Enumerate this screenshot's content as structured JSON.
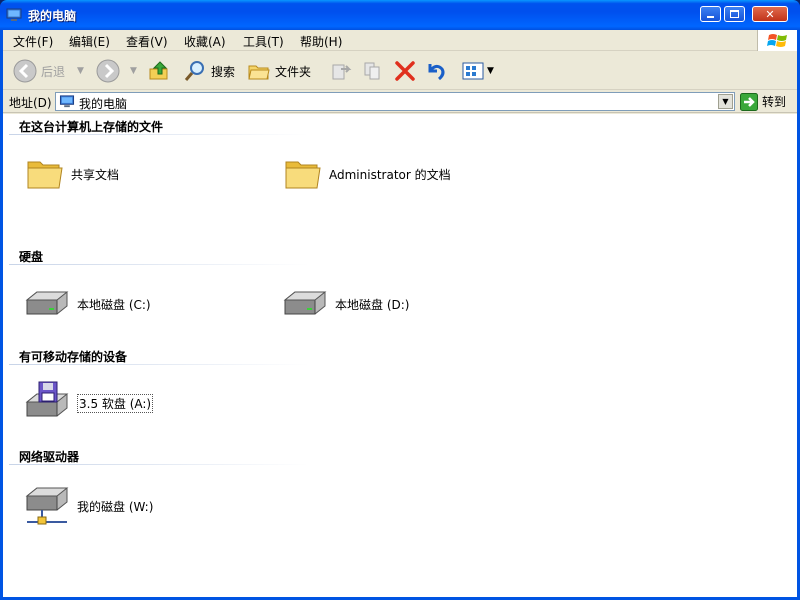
{
  "window": {
    "title": "我的电脑"
  },
  "menu": [
    "文件(F)",
    "编辑(E)",
    "查看(V)",
    "收藏(A)",
    "工具(T)",
    "帮助(H)"
  ],
  "toolbar": {
    "back": "后退",
    "search": "搜索",
    "folders": "文件夹"
  },
  "address": {
    "label": "地址(D)",
    "value": "我的电脑",
    "go": "转到"
  },
  "groups": [
    {
      "title": "在这台计算机上存储的文件",
      "items": [
        {
          "label": "共享文档",
          "icon": "folder-icon"
        },
        {
          "label": "Administrator 的文档",
          "icon": "folder-icon"
        }
      ]
    },
    {
      "title": "硬盘",
      "items": [
        {
          "label": "本地磁盘 (C:)",
          "icon": "hard-drive-icon"
        },
        {
          "label": "本地磁盘 (D:)",
          "icon": "hard-drive-icon"
        }
      ]
    },
    {
      "title": "有可移动存储的设备",
      "items": [
        {
          "label": "3.5 软盘 (A:)",
          "icon": "floppy-drive-icon"
        }
      ]
    },
    {
      "title": "网络驱动器",
      "items": [
        {
          "label": "我的磁盘 (W:)",
          "icon": "network-drive-icon"
        }
      ]
    }
  ],
  "colors": {
    "titlebar": "#0054e3",
    "chrome": "#ece9d8",
    "folder": "#f5d56a"
  }
}
